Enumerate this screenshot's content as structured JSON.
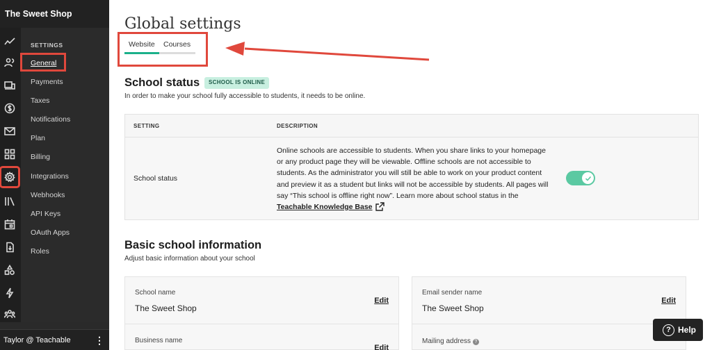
{
  "brand": "The Sweet Shop",
  "sidebar": {
    "section_title": "SETTINGS",
    "items": [
      "General",
      "Payments",
      "Taxes",
      "Notifications",
      "Plan",
      "Billing",
      "Integrations",
      "Webhooks",
      "API Keys",
      "OAuth Apps",
      "Roles"
    ],
    "active_item": "General",
    "rail_icons": [
      "trend-icon",
      "users-icon",
      "devices-icon",
      "dollar-icon",
      "mail-icon",
      "grid-icon",
      "gear-icon",
      "library-icon",
      "calendar-icon",
      "download-icon",
      "shapes-icon",
      "bolt-icon",
      "community-icon"
    ],
    "active_rail_icon": "gear-icon",
    "user": "Taylor @ Teachable"
  },
  "page": {
    "title": "Global settings",
    "tabs": [
      "Website",
      "Courses"
    ],
    "active_tab": "Website"
  },
  "school_status": {
    "heading": "School status",
    "badge": "SCHOOL IS ONLINE",
    "subtitle": "In order to make your school fully accessible to students, it needs to be online.",
    "table": {
      "col_setting": "SETTING",
      "col_description": "DESCRIPTION",
      "row_setting": "School status",
      "row_description": "Online schools are accessible to students. When you share links to your homepage or any product page they will be viewable. Offline schools are not accessible to students. As the administrator you will still be able to work on your product content and preview it as a student but links will not be accessible by students. All pages will say “This school is offline right now”. Learn more about school status in the",
      "link_text": "Teachable Knowledge Base",
      "toggle_on": true
    }
  },
  "basic_info": {
    "heading": "Basic school information",
    "subtitle": "Adjust basic information about your school",
    "left_card": [
      {
        "label": "School name",
        "value": "The Sweet Shop",
        "action": "Edit"
      },
      {
        "label": "Business name",
        "value": "",
        "action": "Edit"
      }
    ],
    "right_card": [
      {
        "label": "Email sender name",
        "value": "The Sweet Shop",
        "action": "Edit"
      },
      {
        "label": "Mailing address",
        "value": "",
        "action": ""
      }
    ]
  },
  "help": {
    "label": "Help"
  },
  "colors": {
    "accent_green": "#1bb08a",
    "annotation_red": "#e0483c",
    "sidebar_bg": "#2a2a2a"
  }
}
